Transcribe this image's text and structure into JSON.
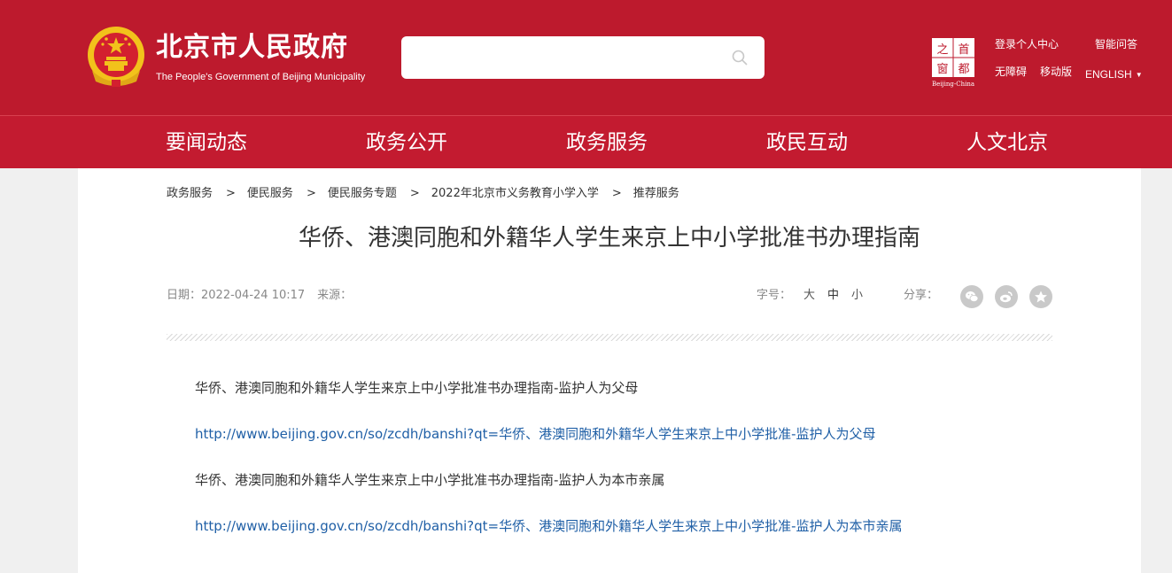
{
  "header": {
    "title": "北京市人民政府",
    "subtitle": "The People's Government of Beijing Municipality",
    "search": {
      "placeholder": ""
    },
    "capital_logo": {
      "chars": [
        "之",
        "首",
        "窗",
        "都"
      ],
      "caption": "Beijing-China"
    },
    "links": {
      "login": "登录个人中心",
      "qa": "智能问答",
      "accessibility": "无障碍",
      "mobile": "移动版",
      "language": "ENGLISH",
      "language_caret": "▼"
    }
  },
  "nav": {
    "items": [
      "要闻动态",
      "政务公开",
      "政务服务",
      "政民互动",
      "人文北京"
    ]
  },
  "breadcrumb": {
    "items": [
      "政务服务",
      "便民服务",
      "便民服务专题",
      "2022年北京市义务教育小学入学",
      "推荐服务"
    ],
    "separator": ">"
  },
  "article": {
    "title": "华侨、港澳同胞和外籍华人学生来京上中小学批准书办理指南",
    "date_label": "日期：",
    "date": "2022-04-24 10:17",
    "source_label": "来源：",
    "fontsize_label": "字号：",
    "fontsizes": [
      "大",
      "中",
      "小"
    ],
    "share_label": "分享：",
    "share_icons": [
      "wechat-icon",
      "weibo-icon",
      "favorite-icon"
    ],
    "paragraphs": [
      {
        "type": "text",
        "text": "华侨、港澳同胞和外籍华人学生来京上中小学批准书办理指南-监护人为父母"
      },
      {
        "type": "link",
        "text": "http://www.beijing.gov.cn/so/zcdh/banshi?qt=华侨、港澳同胞和外籍华人学生来京上中小学批准-监护人为父母"
      },
      {
        "type": "text",
        "text": "华侨、港澳同胞和外籍华人学生来京上中小学批准书办理指南-监护人为本市亲属"
      },
      {
        "type": "link",
        "text": "http://www.beijing.gov.cn/so/zcdh/banshi?qt=华侨、港澳同胞和外籍华人学生来京上中小学批准-监护人为本市亲属"
      }
    ]
  },
  "colors": {
    "header_bg": "#bd1a2d",
    "nav_bg": "#c31b30",
    "link": "#1f5fa6",
    "emblem_gold": "#f2c21b"
  }
}
